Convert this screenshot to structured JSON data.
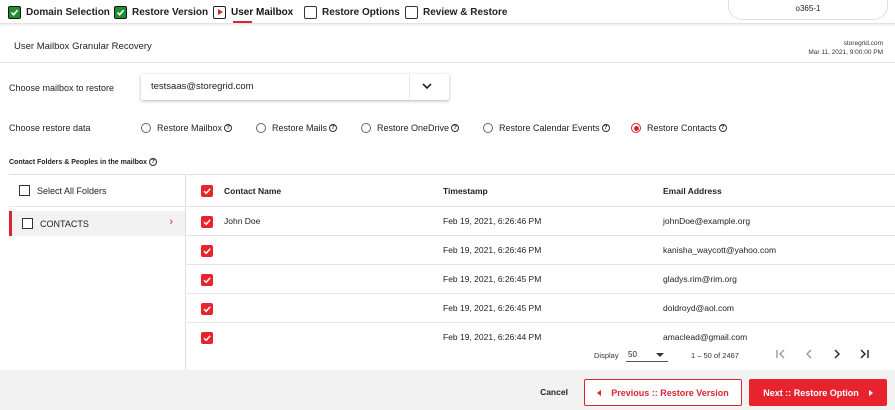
{
  "wizard": {
    "steps": [
      {
        "label": "Domain Selection",
        "state": "done"
      },
      {
        "label": "Restore Version",
        "state": "done"
      },
      {
        "label": "User Mailbox",
        "state": "current"
      },
      {
        "label": "Restore Options",
        "state": "pending"
      },
      {
        "label": "Review & Restore",
        "state": "pending"
      }
    ],
    "tenant": "o365-1"
  },
  "header": {
    "title": "User Mailbox Granular Recovery",
    "server": "storegrid.com",
    "datetime": "Mar 11, 2021, 9:00:00 PM"
  },
  "mailbox": {
    "label": "Choose mailbox to restore",
    "value": "testsaas@storegrid.com"
  },
  "restore_data": {
    "label": "Choose restore data",
    "options": [
      {
        "label": "Restore Mailbox",
        "selected": false
      },
      {
        "label": "Restore Mails",
        "selected": false
      },
      {
        "label": "Restore OneDrive",
        "selected": false
      },
      {
        "label": "Restore Calendar Events",
        "selected": false
      },
      {
        "label": "Restore Contacts",
        "selected": true
      }
    ]
  },
  "section_title": "Contact Folders & Peoples in the mailbox",
  "folders": {
    "select_all": "Select All Folders",
    "items": [
      {
        "label": "CONTACTS"
      }
    ]
  },
  "table": {
    "columns": [
      "Contact Name",
      "Timestamp",
      "Email Address"
    ],
    "rows": [
      {
        "name": "John Doe",
        "timestamp": "Feb 19, 2021, 6:26:46 PM",
        "email": "johnDoe@example.org",
        "checked": true
      },
      {
        "name": "",
        "timestamp": "Feb 19, 2021, 6:26:46 PM",
        "email": "kanisha_waycott@yahoo.com",
        "checked": true
      },
      {
        "name": "",
        "timestamp": "Feb 19, 2021, 6:26:45 PM",
        "email": "gladys.rim@rim.org",
        "checked": true
      },
      {
        "name": "",
        "timestamp": "Feb 19, 2021, 6:26:45 PM",
        "email": "doldroyd@aol.com",
        "checked": true
      },
      {
        "name": "",
        "timestamp": "Feb 19, 2021, 6:26:44 PM",
        "email": "amaclead@gmail.com",
        "checked": true
      }
    ]
  },
  "pager": {
    "display_label": "Display",
    "page_size": "50",
    "range": "1 – 50 of 2467"
  },
  "footer": {
    "cancel": "Cancel",
    "prev": "Previous :: Restore Version",
    "next": "Next :: Restore Option"
  },
  "colors": {
    "accent": "#e8232e",
    "done": "#1d8f2e"
  }
}
